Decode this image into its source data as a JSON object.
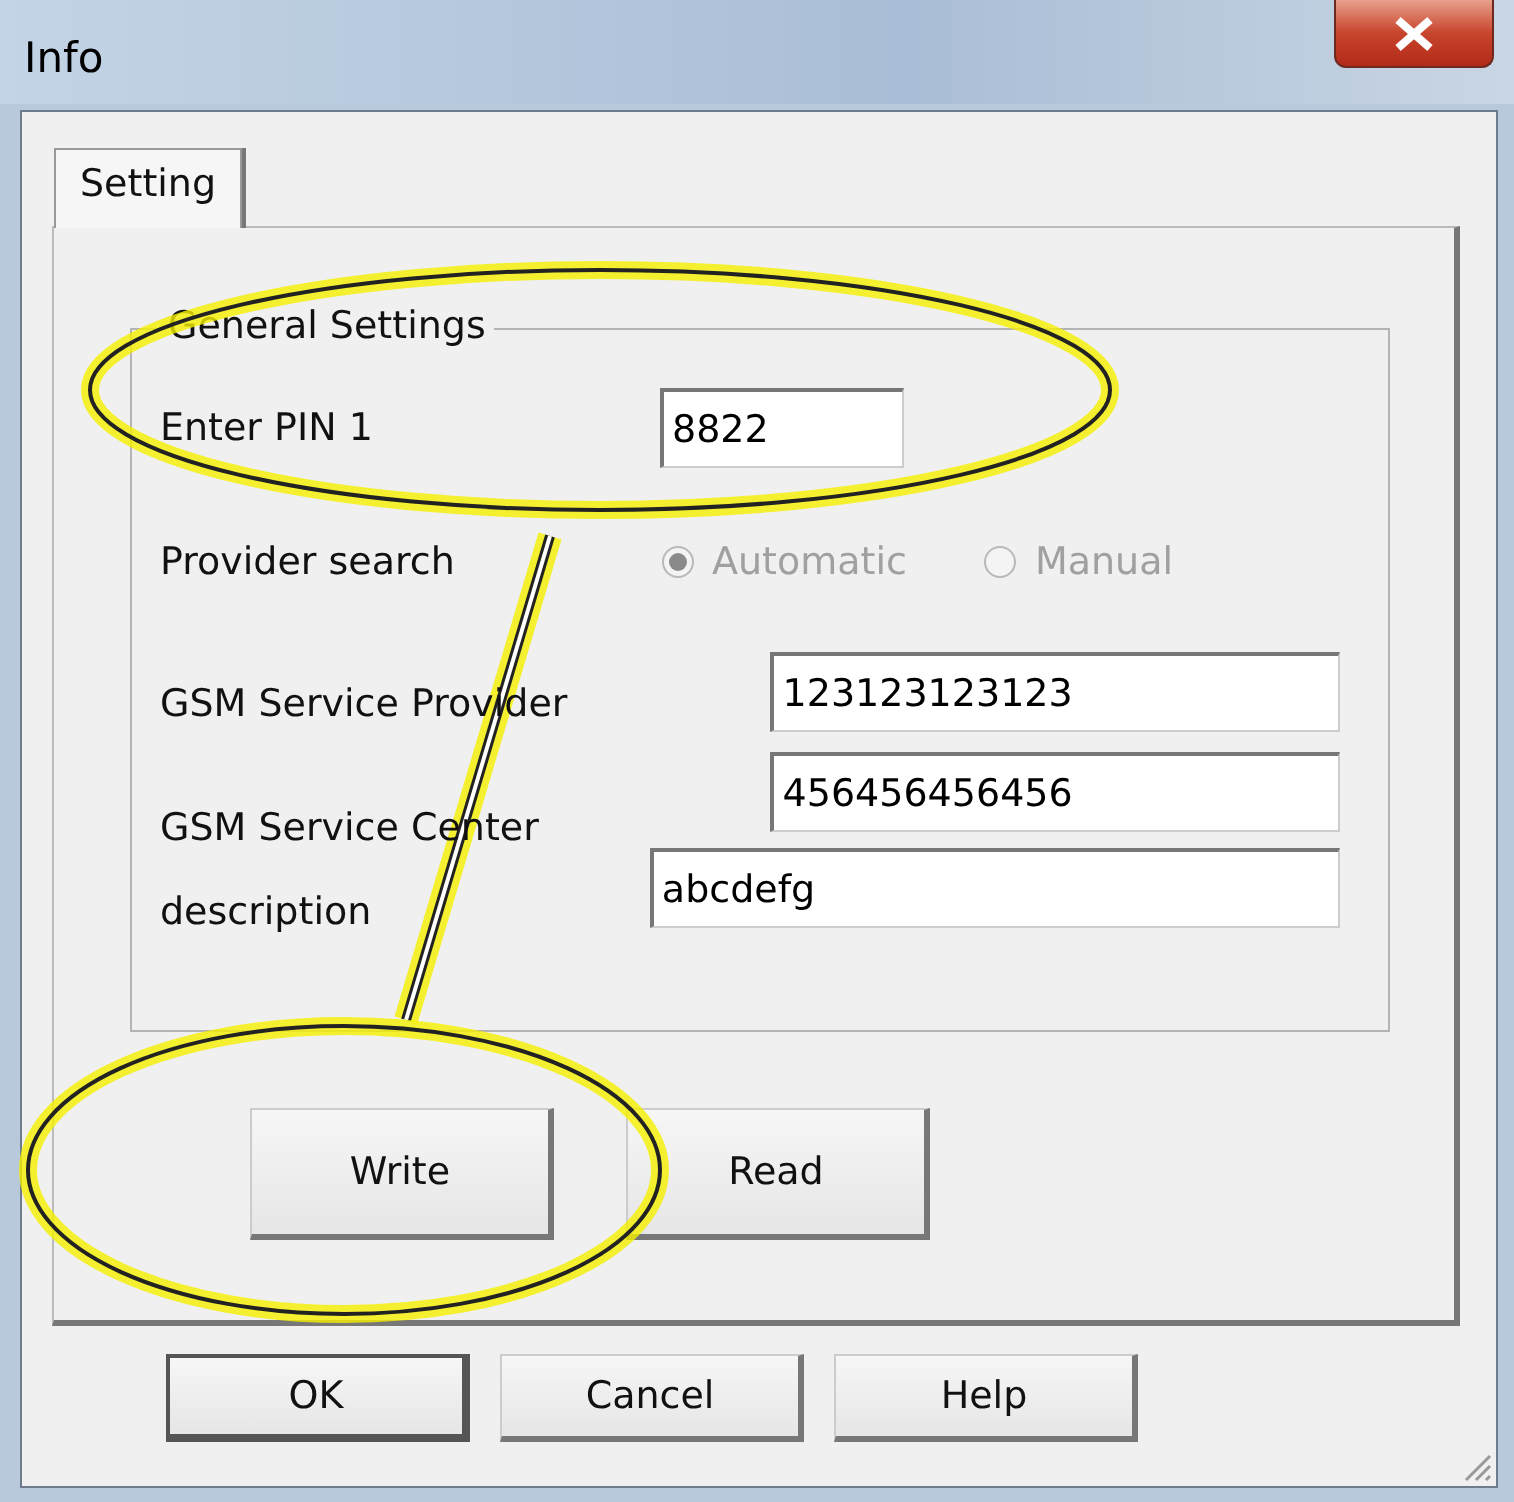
{
  "window": {
    "title": "Info"
  },
  "tabs": [
    {
      "label": "Setting",
      "selected": true
    }
  ],
  "group": {
    "title": "General Settings",
    "pin": {
      "label": "Enter PIN 1",
      "value": "8822"
    },
    "provider_search": {
      "label": "Provider search",
      "disabled": true,
      "options": [
        {
          "label": "Automatic",
          "selected": true
        },
        {
          "label": "Manual",
          "selected": false
        }
      ]
    },
    "fields": [
      {
        "label": "GSM Service Provider",
        "value": "123123123123"
      },
      {
        "label": "GSM Service Center",
        "value": "456456456456"
      },
      {
        "label": "description",
        "value": "abcdefg"
      }
    ]
  },
  "panel_buttons": [
    "Write",
    "Read"
  ],
  "dialog_buttons": [
    {
      "label": "OK",
      "default": true
    },
    {
      "label": "Cancel",
      "default": false
    },
    {
      "label": "Help",
      "default": false
    }
  ],
  "annotations": [
    {
      "kind": "ellipse"
    },
    {
      "kind": "line"
    },
    {
      "kind": "ellipse"
    }
  ]
}
